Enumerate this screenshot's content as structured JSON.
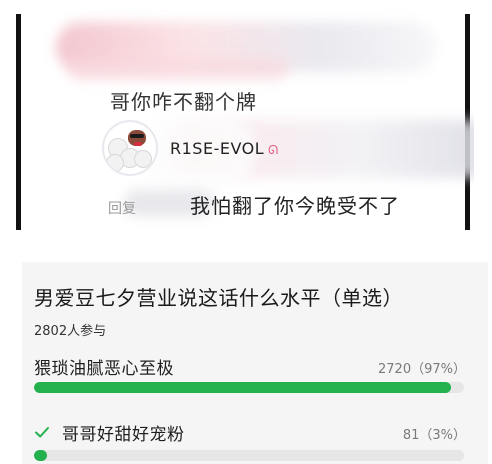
{
  "post": {
    "question_text": "哥你咋不翻个牌",
    "profile_name": "R1SE-EVOL",
    "reply_prefix": "回复",
    "reply_text": "我怕翻了你今晚受不了"
  },
  "poll": {
    "title": "男爱豆七夕营业说这话什么水平（单选）",
    "participants": "2802人参与",
    "options": [
      {
        "label": "猥琐油腻恶心至极",
        "count": "2720（97%）",
        "fraction": 0.97,
        "selected": false
      },
      {
        "label": "哥哥好甜好宠粉",
        "count": "81（3%）",
        "fraction": 0.03,
        "selected": true
      }
    ]
  },
  "colors": {
    "progress": "#23b14d",
    "check": "#23b14d",
    "track": "#e6e6e6",
    "card_bg": "#f5f5f5"
  },
  "icons": {
    "selected_marker": "check-icon"
  }
}
